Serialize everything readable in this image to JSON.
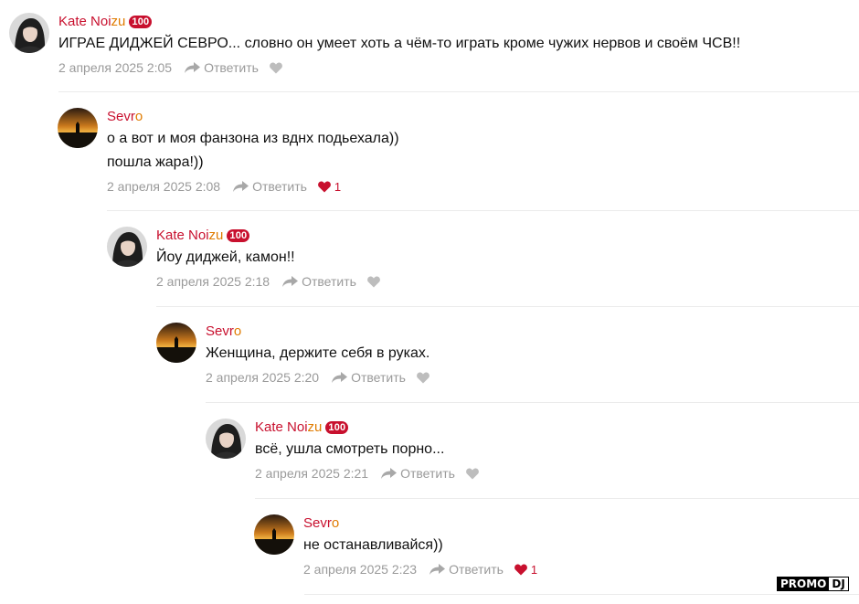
{
  "comments": [
    {
      "author_main": "Kate Noi",
      "author_accent": "zu",
      "badge": "100",
      "lines": [
        "ИГРАЕ ДИДЖЕЙ СЕВРО... словно он умеет хоть а чём-то играть кроме чужих нервов и своём ЧСВ!!"
      ],
      "date": "2 апреля 2025 2:05",
      "reply_label": "Ответить",
      "liked": false,
      "likes": ""
    },
    {
      "author_main": "Sevr",
      "author_accent": "o",
      "badge": "",
      "lines": [
        "о а вот и моя фанзона из вднх подьехала))",
        "пошла жара!))"
      ],
      "date": "2 апреля 2025 2:08",
      "reply_label": "Ответить",
      "liked": true,
      "likes": "1"
    },
    {
      "author_main": "Kate Noi",
      "author_accent": "zu",
      "badge": "100",
      "lines": [
        "Йоу диджей, камон!!"
      ],
      "date": "2 апреля 2025 2:18",
      "reply_label": "Ответить",
      "liked": false,
      "likes": ""
    },
    {
      "author_main": "Sevr",
      "author_accent": "o",
      "badge": "",
      "lines": [
        "Женщина, держите себя в руках."
      ],
      "date": "2 апреля 2025 2:20",
      "reply_label": "Ответить",
      "liked": false,
      "likes": ""
    },
    {
      "author_main": "Kate Noi",
      "author_accent": "zu",
      "badge": "100",
      "lines": [
        "всё, ушла смотреть порно..."
      ],
      "date": "2 апреля 2025 2:21",
      "reply_label": "Ответить",
      "liked": false,
      "likes": ""
    },
    {
      "author_main": "Sevr",
      "author_accent": "o",
      "badge": "",
      "lines": [
        "не останавливайся))"
      ],
      "date": "2 апреля 2025 2:23",
      "reply_label": "Ответить",
      "liked": true,
      "likes": "1"
    }
  ],
  "watermark": {
    "part1": "PROMO",
    "part2": "DJ"
  },
  "colors": {
    "accent": "#c8102e",
    "accent_secondary": "#e07b00",
    "meta": "#9a9a9a",
    "divider": "#ebebeb"
  },
  "icons": {
    "reply": "reply-arrow-icon",
    "like": "heart-icon"
  }
}
